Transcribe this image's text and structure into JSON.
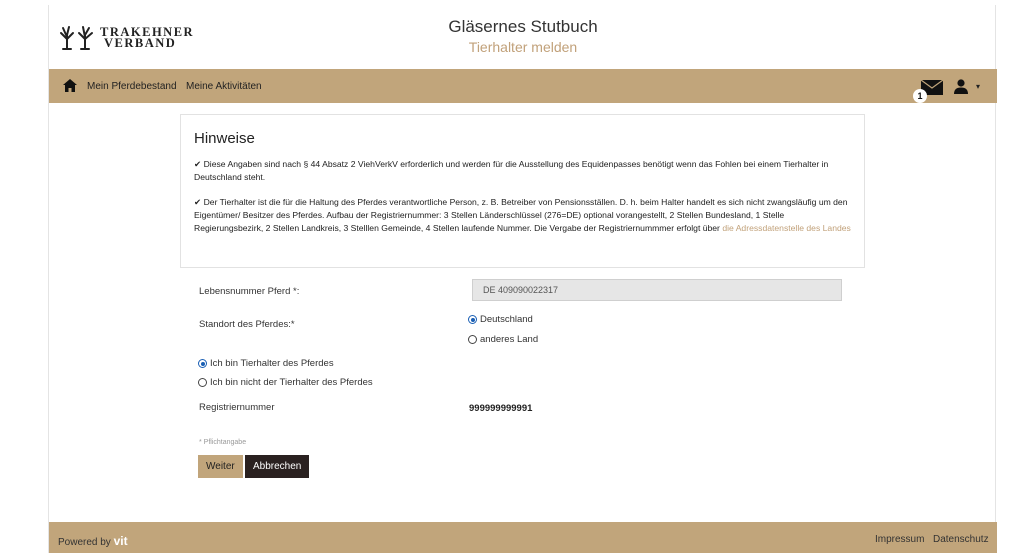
{
  "header": {
    "logo_line1": "TRAKEHNER",
    "logo_line2": "VERBAND",
    "title": "Gläsernes Stutbuch",
    "subtitle": "Tierhalter melden"
  },
  "nav": {
    "items": [
      {
        "label": "Mein Pferdebestand"
      },
      {
        "label": "Meine Aktivitäten"
      }
    ],
    "mail_badge": "1",
    "caret": "▾",
    "icons": [
      "home-icon",
      "mail-icon",
      "user-icon"
    ]
  },
  "hinweise": {
    "title": "Hinweise",
    "note1": "✔ Diese Angaben sind nach § 44 Absatz 2 ViehVerkV erforderlich und werden für die Ausstellung des Equidenpasses benötigt wenn das Fohlen bei einem Tierhalter in Deutschland steht.",
    "note2_text": "✔ Der Tierhalter ist die für die Haltung des Pferdes verantwortliche Person, z. B. Betreiber von Pensionsställen. D. h. beim Halter handelt es sich nicht zwangsläufig um den Eigentümer/ Besitzer des Pferdes. Aufbau der Registriernummer: 3 Stellen Länderschlüssel (276=DE) optional vorangestellt, 2 Stellen Bundesland, 1 Stelle Regierungsbezirk, 2 Stellen Landkreis, 3 Stelllen Gemeinde, 4 Stellen laufende Nummer. Die Vergabe der Registriernummmer erfolgt über ",
    "note2_link": "die Adressdatenstelle des Landes"
  },
  "form": {
    "lebensnummer_label": "Lebensnummer Pferd *:",
    "lebensnummer_value": "DE 409090022317",
    "standort_label": "Standort des Pferdes:*",
    "standort_options": [
      {
        "label": "Deutschland",
        "checked": true
      },
      {
        "label": "anderes Land",
        "checked": false
      }
    ],
    "halter_options": [
      {
        "label": "Ich bin Tierhalter des Pferdes",
        "checked": true
      },
      {
        "label": "Ich bin nicht der Tierhalter des Pferdes",
        "checked": false
      }
    ],
    "registriernummer_label": "Registriernummer",
    "registriernummer_value": "999999999991",
    "pflicht_note": "* Pflichtangabe",
    "weiter_label": "Weiter",
    "abbrechen_label": "Abbrechen"
  },
  "footer": {
    "powered_by": "Powered by",
    "brand": "vit",
    "impressum": "Impressum",
    "datenschutz": "Datenschutz"
  },
  "colors": {
    "accent": "#c1a57b",
    "dark_button": "#2a2120",
    "link": "#c1a17a"
  }
}
